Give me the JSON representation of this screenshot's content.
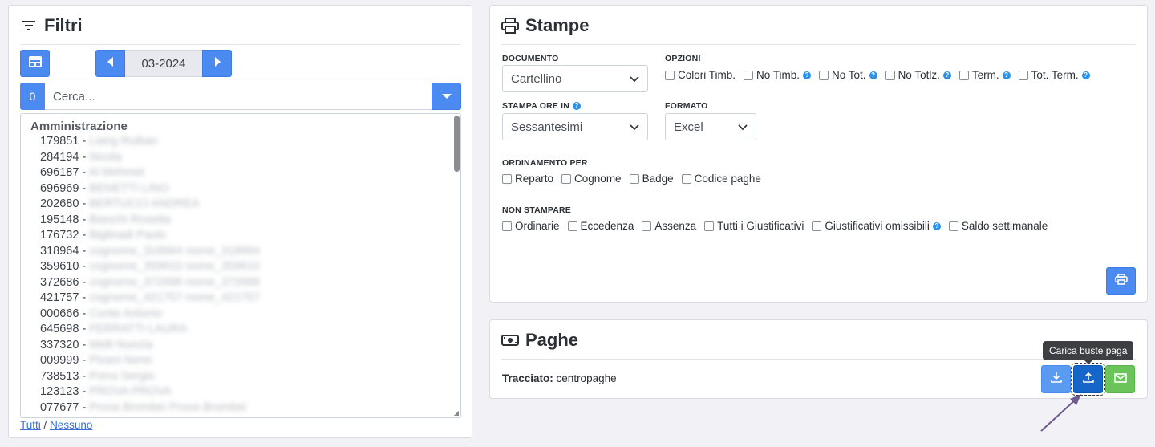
{
  "filtri": {
    "title": "Filtri",
    "month": "03-2024",
    "count": "0",
    "search_placeholder": "Cerca...",
    "group": "Amministrazione",
    "employees": [
      {
        "code": "179851 -",
        "name": "Liang Ruibao"
      },
      {
        "code": "284194 -",
        "name": "Nicola"
      },
      {
        "code": "696187 -",
        "name": "Al Mehmet"
      },
      {
        "code": "696969 -",
        "name": "BENETTI LINO"
      },
      {
        "code": "202680 -",
        "name": "BERTUCCI ANDREA"
      },
      {
        "code": "195148 -",
        "name": "Bianchi Rosetta"
      },
      {
        "code": "176732 -",
        "name": "Biglinadi Paolo"
      },
      {
        "code": "318964 -",
        "name": "cognome_318964 nome_318964"
      },
      {
        "code": "359610 -",
        "name": "cognome_359610 nome_359610"
      },
      {
        "code": "372686 -",
        "name": "cognome_372686 nome_372686"
      },
      {
        "code": "421757 -",
        "name": "cognome_421757 nome_421757"
      },
      {
        "code": "000666 -",
        "name": "Conte Antonio"
      },
      {
        "code": "645698 -",
        "name": "FERRATTI LAURA"
      },
      {
        "code": "337320 -",
        "name": "Melli Nunzia"
      },
      {
        "code": "009999 -",
        "name": "Pivani Nerei"
      },
      {
        "code": "738513 -",
        "name": "Porra Sergio"
      },
      {
        "code": "123123 -",
        "name": "PROVA PROVA"
      },
      {
        "code": "077677 -",
        "name": "Prova Brombei Prova Brombei"
      }
    ],
    "all_link": "Tutti",
    "separator": "/",
    "none_link": "Nessuno"
  },
  "stampe": {
    "title": "Stampe",
    "documento_label": "DOCUMENTO",
    "documento_value": "Cartellino",
    "opzioni_label": "OPZIONI",
    "opzioni": [
      "Colori Timb.",
      "No Timb.",
      "No Tot.",
      "No Totlz.",
      "Term.",
      "Tot. Term."
    ],
    "stampa_ore_label": "STAMPA ORE IN",
    "stampa_ore_value": "Sessantesimi",
    "formato_label": "FORMATO",
    "formato_value": "Excel",
    "ordinamento_label": "ORDINAMENTO PER",
    "ordinamento": [
      "Reparto",
      "Cognome",
      "Badge",
      "Codice paghe"
    ],
    "non_stampare_label": "NON STAMPARE",
    "non_stampare": [
      "Ordinarie",
      "Eccedenza",
      "Assenza",
      "Tutti i Giustificativi",
      "Giustificativi omissibili",
      "Saldo settimanale"
    ]
  },
  "paghe": {
    "title": "Paghe",
    "tracciato_label": "Tracciato:",
    "tracciato_value": "centropaghe",
    "tooltip": "Carica buste paga"
  },
  "colors": {
    "primary": "#4b8af0",
    "upload": "#1566c8",
    "email": "#6bc45a",
    "help": "#2b90e8"
  }
}
